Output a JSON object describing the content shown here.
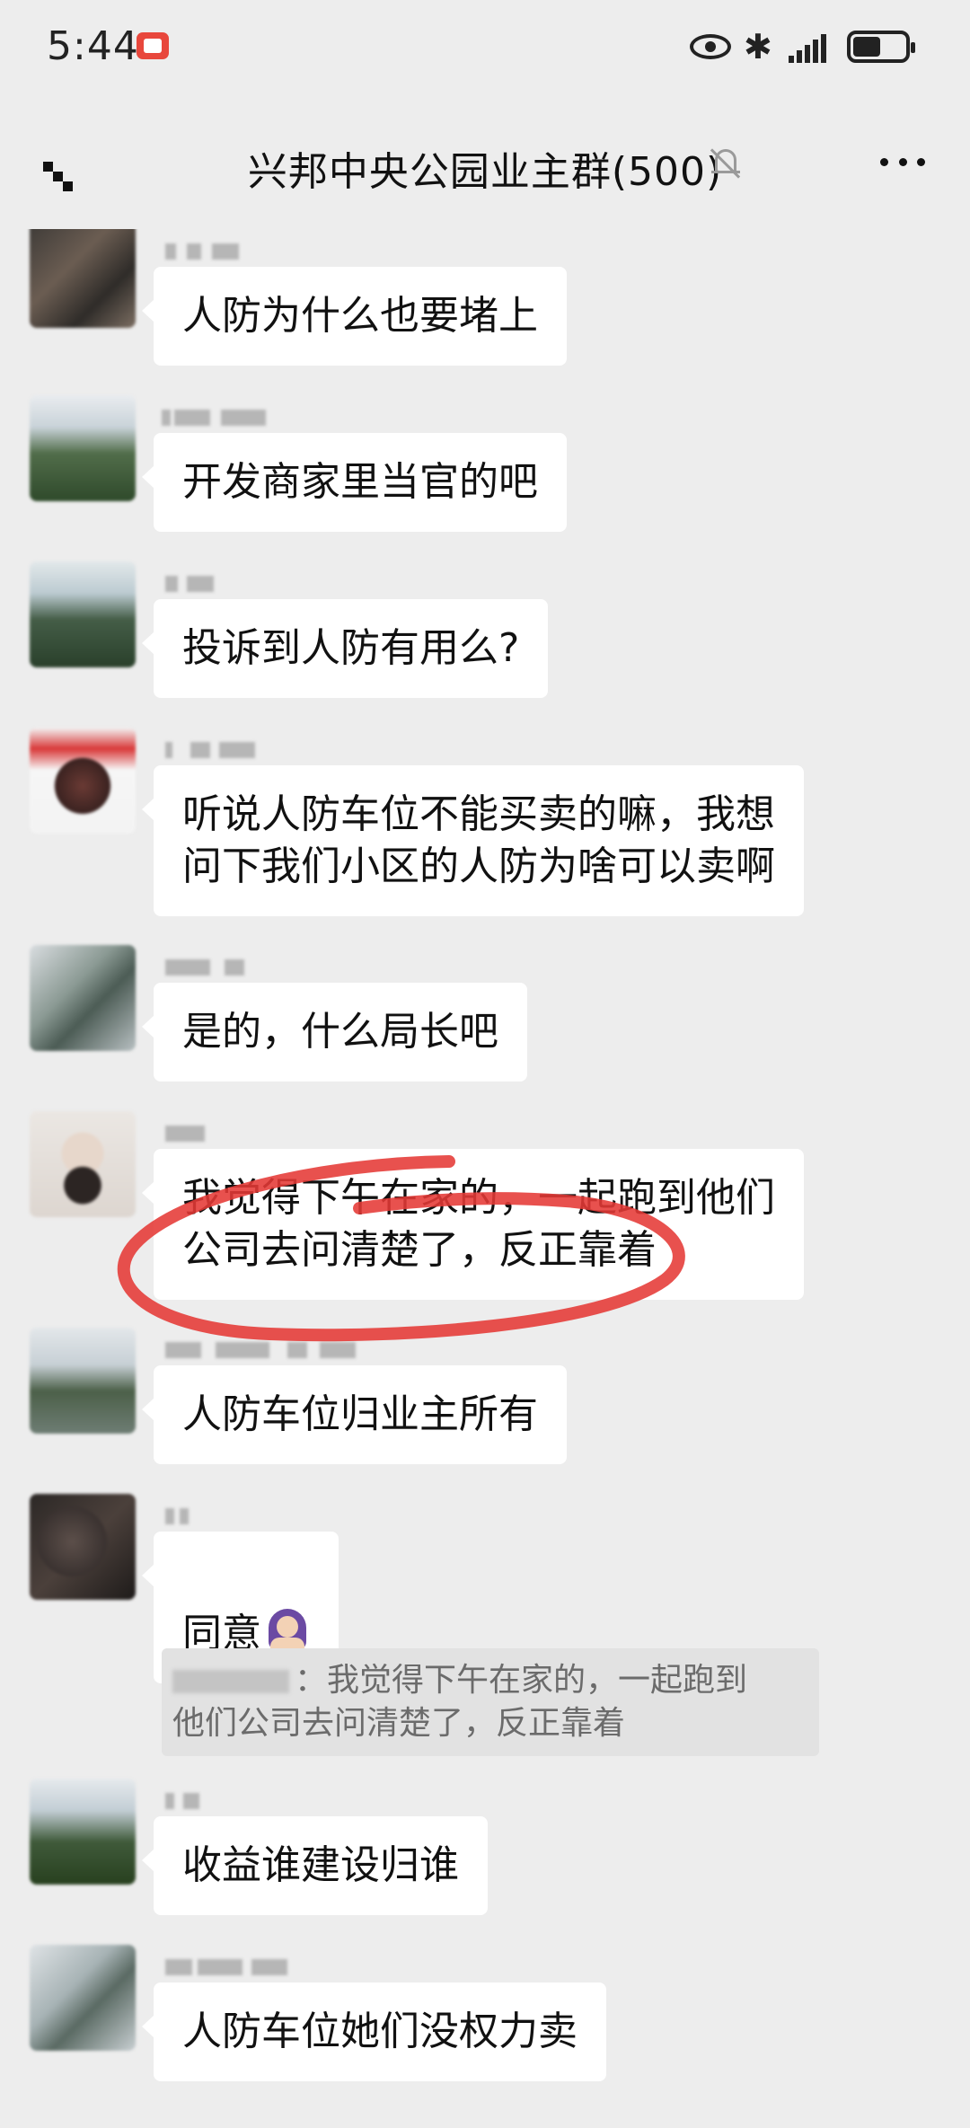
{
  "status_bar": {
    "time": "5:44",
    "icons": [
      "notification-icon",
      "eye-icon",
      "bluetooth-icon",
      "signal-icon",
      "battery-icon"
    ]
  },
  "header": {
    "title": "兴邦中央公园业主群(500)",
    "icons": [
      "back-icon",
      "mute-icon",
      "more-icon"
    ]
  },
  "messages": [
    {
      "text": "人防为什么也要堵上"
    },
    {
      "text": "开发商家里当官的吧"
    },
    {
      "text": "投诉到人防有用么?"
    },
    {
      "text": "听说人防车位不能买卖的嘛，我想\n问下我们小区的人防为啥可以卖啊"
    },
    {
      "text": "是的，什么局长吧",
      "highlighted": true
    },
    {
      "text": "我觉得下午在家的，一起跑到他们\n公司去问清楚了，反正靠着"
    },
    {
      "text": "人防车位归业主所有"
    },
    {
      "text": "同意",
      "emoji": "woman-gesturing-emoji",
      "quote": "：我觉得下午在家的，一起跑到\n他们公司去问清楚了，反正靠着"
    },
    {
      "text": "收益谁建设归谁"
    },
    {
      "text": "人防车位她们没权力卖"
    }
  ],
  "colors": {
    "background": "#ededed",
    "bubble": "#ffffff",
    "quote_background": "#e2e2e2",
    "annotation": "#e53935"
  }
}
